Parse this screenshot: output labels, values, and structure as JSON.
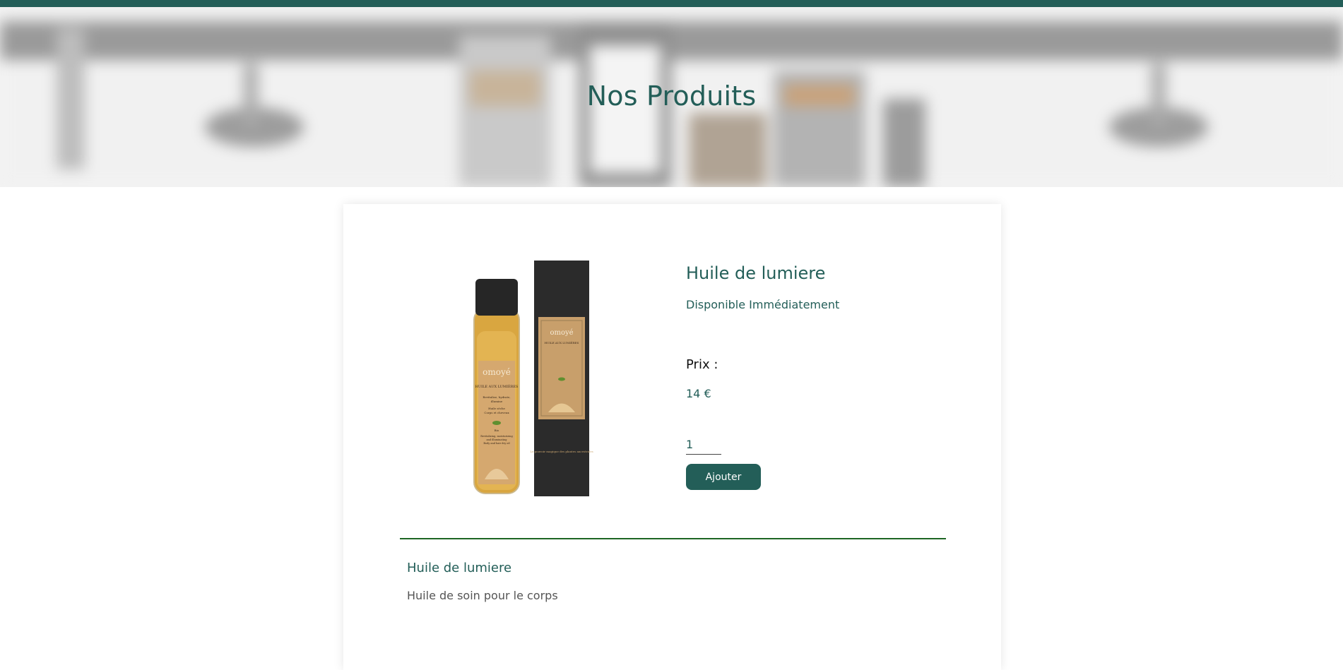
{
  "hero": {
    "title": "Nos Produits"
  },
  "product": {
    "name": "Huile de lumiere",
    "availability": "Disponible Immédiatement",
    "price_label": "Prix :",
    "price": "14 €",
    "quantity": "1",
    "add_label": "Ajouter",
    "image": {
      "bottle_brand": "omoyé",
      "bottle_name": "HUILE AUX LUMIÈRES",
      "bottle_lines": [
        "Revitalise, hydrate,",
        "illumine",
        "Huile sèche",
        "Corps et cheveux",
        "Bio",
        "Revitalizing, moisturizing",
        "and illuminating",
        "Body and hair dry oil"
      ],
      "box_brand": "omoyé",
      "box_name": "HUILE AUX LUMIÈRES",
      "box_tagline": "Le pouvoir magique des plantes ancestrales"
    }
  },
  "description": {
    "title": "Huile de lumiere",
    "text": "Huile de soin pour le corps"
  },
  "colors": {
    "brand": "#235e58",
    "divider": "#1d6524"
  }
}
